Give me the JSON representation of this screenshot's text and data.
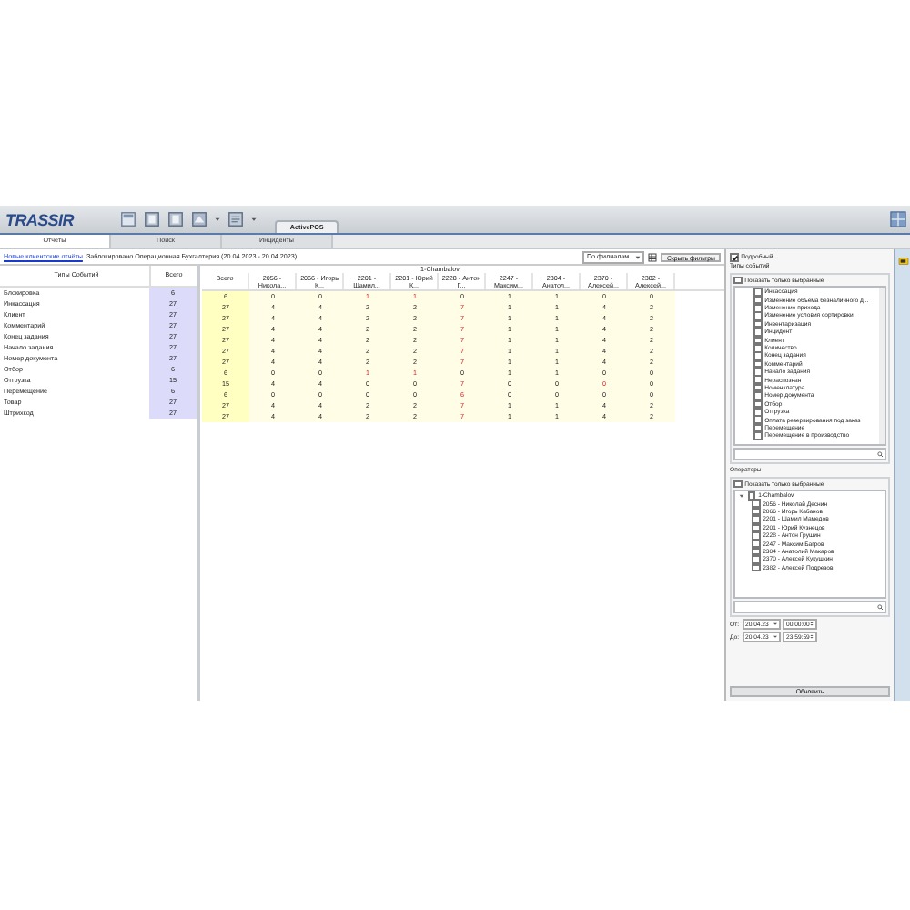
{
  "app": {
    "logo": "TRASSIR",
    "tab": "ActivePOS"
  },
  "tabs": [
    {
      "label": "Отчёты",
      "selected": true
    },
    {
      "label": "Поиск",
      "selected": false
    },
    {
      "label": "Инциденты",
      "selected": false
    }
  ],
  "report": {
    "link": "Новые клиентские отчёты",
    "caption": "Заблокировано Операционная Бухгалтерия (20.04.2023 - 20.04.2023)",
    "grouping": "По филиалам",
    "hide_button": "Скрыть фильтры"
  },
  "summary": {
    "columns": [
      "Типы Событий",
      "Всего"
    ],
    "rows": [
      {
        "type": "Блокировка",
        "total": "6"
      },
      {
        "type": "Инкассация",
        "total": "27"
      },
      {
        "type": "Клиент",
        "total": "27"
      },
      {
        "type": "Комментарий",
        "total": "27"
      },
      {
        "type": "Конец задания",
        "total": "27"
      },
      {
        "type": "Начало задания",
        "total": "27"
      },
      {
        "type": "Номер документа",
        "total": "27"
      },
      {
        "type": "Отбор",
        "total": "6"
      },
      {
        "type": "Отгрузка",
        "total": "15"
      },
      {
        "type": "Перемещение",
        "total": "6"
      },
      {
        "type": "Товар",
        "total": "27"
      },
      {
        "type": "Штрихкод",
        "total": "27"
      }
    ]
  },
  "breakdown": {
    "group": "1-Chambalov",
    "columns": [
      "Всего",
      "2056 - Никола...",
      "2066 - Игорь К...",
      "2201 - Шамил...",
      "2201 - Юрий К...",
      "2228 - Антон Г...",
      "2247 - Максим...",
      "2304 - Анатол...",
      "2370 - Алексей...",
      "2382 - Алексей..."
    ],
    "rows": [
      {
        "values": [
          "6",
          "0",
          "0",
          "1",
          "1",
          "0",
          "1",
          "1",
          "0",
          "0"
        ],
        "alerts": [
          false,
          false,
          false,
          true,
          true,
          false,
          false,
          false,
          false,
          false
        ]
      },
      {
        "values": [
          "27",
          "4",
          "4",
          "2",
          "2",
          "7",
          "1",
          "1",
          "4",
          "2"
        ],
        "alerts": [
          false,
          false,
          false,
          false,
          false,
          true,
          false,
          false,
          false,
          false
        ]
      },
      {
        "values": [
          "27",
          "4",
          "4",
          "2",
          "2",
          "7",
          "1",
          "1",
          "4",
          "2"
        ],
        "alerts": [
          false,
          false,
          false,
          false,
          false,
          true,
          false,
          false,
          false,
          false
        ]
      },
      {
        "values": [
          "27",
          "4",
          "4",
          "2",
          "2",
          "7",
          "1",
          "1",
          "4",
          "2"
        ],
        "alerts": [
          false,
          false,
          false,
          false,
          false,
          true,
          false,
          false,
          false,
          false
        ]
      },
      {
        "values": [
          "27",
          "4",
          "4",
          "2",
          "2",
          "7",
          "1",
          "1",
          "4",
          "2"
        ],
        "alerts": [
          false,
          false,
          false,
          false,
          false,
          true,
          false,
          false,
          false,
          false
        ]
      },
      {
        "values": [
          "27",
          "4",
          "4",
          "2",
          "2",
          "7",
          "1",
          "1",
          "4",
          "2"
        ],
        "alerts": [
          false,
          false,
          false,
          false,
          false,
          true,
          false,
          false,
          false,
          false
        ]
      },
      {
        "values": [
          "27",
          "4",
          "4",
          "2",
          "2",
          "7",
          "1",
          "1",
          "4",
          "2"
        ],
        "alerts": [
          false,
          false,
          false,
          false,
          false,
          true,
          false,
          false,
          false,
          false
        ]
      },
      {
        "values": [
          "6",
          "0",
          "0",
          "1",
          "1",
          "0",
          "1",
          "1",
          "0",
          "0"
        ],
        "alerts": [
          false,
          false,
          false,
          true,
          true,
          false,
          false,
          false,
          false,
          false
        ]
      },
      {
        "values": [
          "15",
          "4",
          "4",
          "0",
          "0",
          "7",
          "0",
          "0",
          "0",
          "0"
        ],
        "alerts": [
          false,
          false,
          false,
          false,
          false,
          true,
          false,
          false,
          true,
          false
        ]
      },
      {
        "values": [
          "6",
          "0",
          "0",
          "0",
          "0",
          "6",
          "0",
          "0",
          "0",
          "0"
        ],
        "alerts": [
          false,
          false,
          false,
          false,
          false,
          true,
          false,
          false,
          false,
          false
        ]
      },
      {
        "values": [
          "27",
          "4",
          "4",
          "2",
          "2",
          "7",
          "1",
          "1",
          "4",
          "2"
        ],
        "alerts": [
          false,
          false,
          false,
          false,
          false,
          true,
          false,
          false,
          false,
          false
        ]
      },
      {
        "values": [
          "27",
          "4",
          "4",
          "2",
          "2",
          "7",
          "1",
          "1",
          "4",
          "2"
        ],
        "alerts": [
          false,
          false,
          false,
          false,
          false,
          true,
          false,
          false,
          false,
          false
        ]
      }
    ]
  },
  "filters": {
    "detailed": {
      "label": "Подробный",
      "checked": true
    },
    "event_types": {
      "title": "Типы событий",
      "show_selected": {
        "label": "Показать только выбранные",
        "checked": false
      },
      "items": [
        {
          "label": "Инкассация",
          "checked": false
        },
        {
          "label": "Изменение объёма безналичного д...",
          "checked": false
        },
        {
          "label": "Изменение прихода",
          "checked": false
        },
        {
          "label": "Изменение условия сортировки",
          "checked": false
        },
        {
          "label": "Инвентаризация",
          "checked": false
        },
        {
          "label": "Инцидент",
          "checked": false
        },
        {
          "label": "Клиент",
          "checked": false
        },
        {
          "label": "Количество",
          "checked": false
        },
        {
          "label": "Конец задания",
          "checked": false
        },
        {
          "label": "Комментарий",
          "checked": false
        },
        {
          "label": "Начало задания",
          "checked": false
        },
        {
          "label": "Нераспознан",
          "checked": false
        },
        {
          "label": "Номенклатура",
          "checked": false
        },
        {
          "label": "Номер документа",
          "checked": false
        },
        {
          "label": "Отбор",
          "checked": false
        },
        {
          "label": "Отгрузка",
          "checked": false
        },
        {
          "label": "Оплата резервирования под заказ",
          "checked": false
        },
        {
          "label": "Перемещение",
          "checked": false
        },
        {
          "label": "Перемещение в производство",
          "checked": false
        }
      ]
    },
    "operators": {
      "title": "Операторы",
      "show_selected": {
        "label": "Показать только выбранные",
        "checked": false
      },
      "tree": [
        {
          "label": "1-Chambalov",
          "checked": false,
          "expanded": true,
          "children": [
            {
              "label": "2056 - Николай Деснин",
              "checked": false
            },
            {
              "label": "2066 - Игорь Кабанов",
              "checked": false
            },
            {
              "label": "2201 - Шамил Мамедов",
              "checked": false
            },
            {
              "label": "2201 - Юрий Кузнецов",
              "checked": false
            },
            {
              "label": "2228 - Антон Грушин",
              "checked": false
            },
            {
              "label": "2247 - Максим Багров",
              "checked": false
            },
            {
              "label": "2304 - Анатолий Макаров",
              "checked": false
            },
            {
              "label": "2370 - Алексей Кукушкин",
              "checked": false
            },
            {
              "label": "2382 - Алексей Подрезов",
              "checked": false
            }
          ]
        }
      ]
    },
    "dates": [
      {
        "label": "От:",
        "date": "20.04.23",
        "time": "00:00:00"
      },
      {
        "label": "До:",
        "date": "20.04.23",
        "time": "23:59:59"
      }
    ],
    "refresh_button": "Обновить"
  }
}
